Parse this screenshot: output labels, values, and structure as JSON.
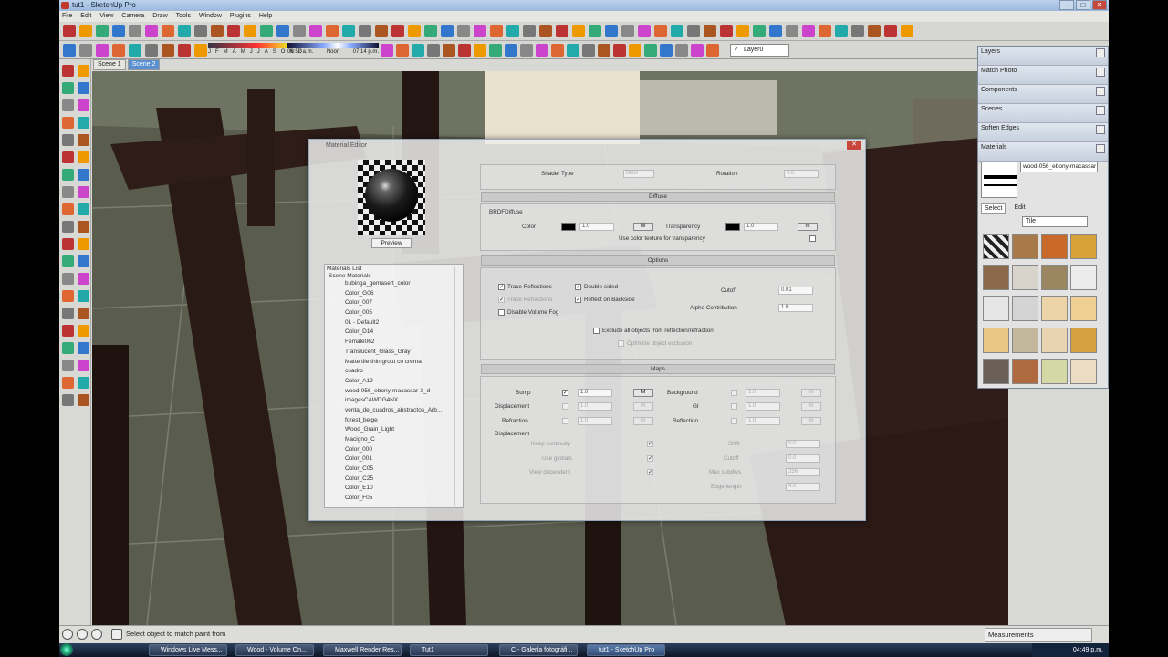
{
  "window": {
    "title": "tut1 - SketchUp Pro"
  },
  "menu": [
    "File",
    "Edit",
    "View",
    "Camera",
    "Draw",
    "Tools",
    "Window",
    "Plugins",
    "Help"
  ],
  "toolbar": {
    "months": [
      "J",
      "F",
      "M",
      "A",
      "M",
      "J",
      "J",
      "A",
      "S",
      "O",
      "N",
      "D"
    ],
    "time_start": "06:52 a.m.",
    "time_mid": "Noon",
    "time_end": "07:14 p.m.",
    "layer": "Layer0"
  },
  "scenes": [
    "Scene 1",
    "Scene 2"
  ],
  "trays": [
    "Layers",
    "Match Photo",
    "Components",
    "Scenes",
    "Soften Edges",
    "Materials"
  ],
  "materials_panel": {
    "current": "wood-056_ebony-macassar",
    "select_tab": "Select",
    "edit_tab": "Edit",
    "library": "Tile"
  },
  "editor": {
    "title": "Material Editor",
    "preview_button": "Preview",
    "list_title": "Materials List",
    "list_root": "Scene Materials",
    "materials": [
      "bubinga_gemasert_color",
      "Color_G06",
      "Color_007",
      "Color_005",
      "01 - Default2",
      "Color_D14",
      "Female062",
      "Translucent_Glass_Gray",
      "Matte tile thin grout co crema",
      "cuadro",
      "Color_A19",
      "wood-056_ebony-macassar-3_d",
      "imagesCAWDG4NX",
      "venta_de_cuadros_abstractos_Arb...",
      "forest_beige",
      "Wood_Grain_Light",
      "Macigno_C",
      "Color_000",
      "Color_001",
      "Color_C05",
      "Color_C25",
      "Color_E10",
      "Color_F05"
    ],
    "shader_type_label": "Shader Type",
    "shader_type": "Blinn",
    "rotation_label": "Rotation",
    "rotation": "0.0",
    "diffuse_header": "Diffuse",
    "brdf_label": "BRDFDiffuse",
    "color_label": "Color",
    "color_value": "1.0",
    "m_button": "M",
    "transparency_label": "Transparency",
    "transparency_value": "1.0",
    "transparency_m": "m",
    "use_color_tex": "Use color texture for transparency",
    "options_header": "Options",
    "trace_reflections": "Trace Reflections",
    "trace_refractions": "Trace Refractions",
    "disable_volume_fog": "Disable Volume Fog",
    "double_sided": "Double-sided",
    "reflect_on_backside": "Reflect on Backside",
    "cutoff_label": "Cutoff",
    "cutoff": "0.01",
    "alpha_label": "Alpha Contribution",
    "alpha": "1.0",
    "exclude_all": "Exclude all objects from reflection/refraction",
    "optimize_exclusion": "Optimize object exclusion",
    "maps_header": "Maps",
    "bump": "Bump",
    "bump_value": "1.0",
    "displacement": "Displacement",
    "refraction": "Refraction",
    "displacement2": "Displacement",
    "background": "Background",
    "gi": "GI",
    "reflection": "Reflection",
    "keep_continuity": "Keep continuity",
    "use_globals": "Use globals",
    "view_dependent": "View dependent",
    "shift_label": "Shift",
    "shift": "0.0",
    "cutoff2_label": "Cutoff",
    "cutoff2": "0.0",
    "max_subdivs_label": "Max subdivs",
    "max_subdivs": "256",
    "edge_length_label": "Edge length",
    "edge_length": "4.0",
    "map_value": "1.0",
    "map_m": "m"
  },
  "status": {
    "message": "Select object to match paint from",
    "measurements": "Measurements"
  },
  "taskbar": {
    "items": [
      "Windows Live Mess...",
      "Wood - Volume On...",
      "Maxwell Render Res...",
      "Tut1",
      "C - Galería fotográfi...",
      "tut1 - SketchUp Pro"
    ],
    "clock": "04:49 p.m."
  }
}
